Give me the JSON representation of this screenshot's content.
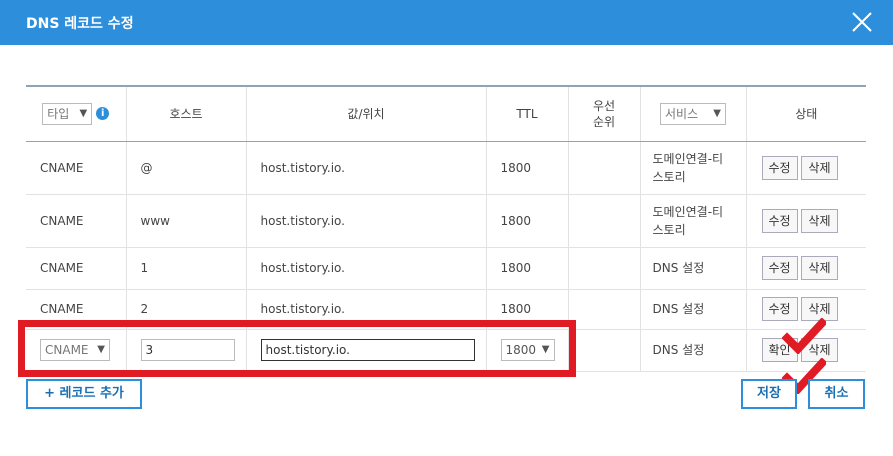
{
  "dialog": {
    "title": "DNS 레코드 수정"
  },
  "table": {
    "headers": {
      "type_filter": "타입",
      "info_icon": "i",
      "host": "호스트",
      "value": "값/위치",
      "ttl": "TTL",
      "priority": "우선\n순위",
      "service_filter": "서비스",
      "status": "상태"
    },
    "rows": [
      {
        "type": "CNAME",
        "host": "@",
        "value": "host.tistory.io.",
        "ttl": "1800",
        "priority": "",
        "service": "도메인연결-티\n스토리",
        "edit": "수정",
        "delete": "삭제"
      },
      {
        "type": "CNAME",
        "host": "www",
        "value": "host.tistory.io.",
        "ttl": "1800",
        "priority": "",
        "service": "도메인연결-티\n스토리",
        "edit": "수정",
        "delete": "삭제"
      },
      {
        "type": "CNAME",
        "host": "1",
        "value": "host.tistory.io.",
        "ttl": "1800",
        "priority": "",
        "service": "DNS 설정",
        "edit": "수정",
        "delete": "삭제"
      },
      {
        "type": "CNAME",
        "host": "2",
        "value": "host.tistory.io.",
        "ttl": "1800",
        "priority": "",
        "service": "DNS 설정",
        "edit": "수정",
        "delete": "삭제"
      }
    ],
    "edit_row": {
      "type": "CNAME",
      "host": "3",
      "value": "host.tistory.io.",
      "ttl": "1800",
      "service": "DNS 설정",
      "confirm": "확인",
      "delete": "삭제"
    }
  },
  "footer": {
    "add_record": "+ 레코드 추가",
    "save": "저장",
    "cancel": "취소"
  },
  "colors": {
    "header_bar": "#2d8fdc",
    "annotation_red": "#e01b24"
  }
}
